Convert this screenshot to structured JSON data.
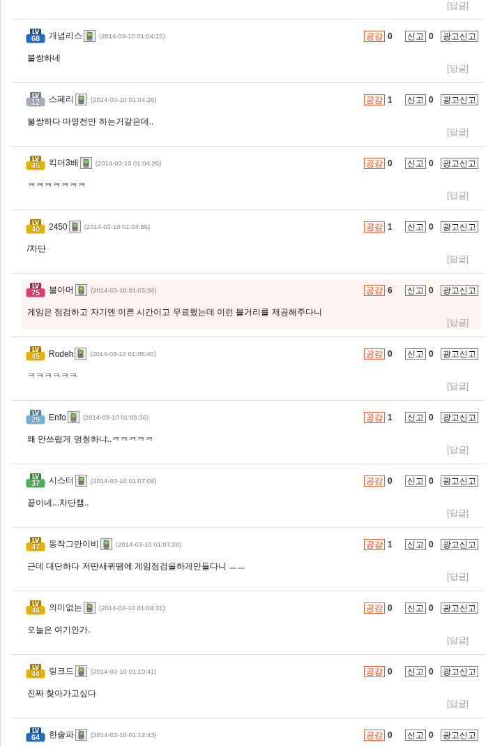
{
  "previous_comment": {
    "reply": "[답글]"
  },
  "comments": [
    {
      "highlighted": false,
      "badge": {
        "label": "LV",
        "number": "68",
        "color": "#1f6cc4"
      },
      "author": "개념리스",
      "time": "(2014-03-10 01:04:15)",
      "like": {
        "label": "공감",
        "count": "0"
      },
      "report": {
        "label": "신고",
        "count": "0"
      },
      "ad_report": {
        "label": "광고신고"
      },
      "text": "불쌍하네",
      "reply": "[답글]"
    },
    {
      "highlighted": false,
      "badge": {
        "label": "LV",
        "number": "12",
        "color": "#a3afbe"
      },
      "author": "스페리",
      "time": "(2014-03-10 01:04:26)",
      "like": {
        "label": "공감",
        "count": "1"
      },
      "report": {
        "label": "신고",
        "count": "0"
      },
      "ad_report": {
        "label": "광고신고"
      },
      "text": "불쌍하다 마영전만 하는거같은데..",
      "reply": "[답글]"
    },
    {
      "highlighted": false,
      "badge": {
        "label": "LV",
        "number": "45",
        "color": "#e8b000"
      },
      "author": "킥더3배",
      "time": "(2014-03-10 01:04:26)",
      "like": {
        "label": "공감",
        "count": "0"
      },
      "report": {
        "label": "신고",
        "count": "0"
      },
      "ad_report": {
        "label": "광고신고"
      },
      "text": "ㅋㅋㅋㅋㅋㅋㅋ",
      "reply": "[답글]"
    },
    {
      "highlighted": false,
      "badge": {
        "label": "LV",
        "number": "40",
        "color": "#e8b000"
      },
      "author": "2450",
      "time": "(2014-03-10 01:04:56)",
      "like": {
        "label": "공감",
        "count": "1"
      },
      "report": {
        "label": "신고",
        "count": "0"
      },
      "ad_report": {
        "label": "광고신고"
      },
      "text": "/차단",
      "reply": "[답글]"
    },
    {
      "highlighted": true,
      "badge": {
        "label": "LV",
        "number": "75",
        "color": "#e23c78"
      },
      "author": "불아머",
      "time": "(2014-03-10 01:05:30)",
      "like": {
        "label": "공감",
        "count": "6"
      },
      "report": {
        "label": "신고",
        "count": "0"
      },
      "ad_report": {
        "label": "광고신고"
      },
      "text": "게임은 점검하고 자기엔 이른 시간이고 무료했는데 이런 볼거리를 제공해주다니",
      "reply": "[답글]"
    },
    {
      "highlighted": false,
      "badge": {
        "label": "LV",
        "number": "45",
        "color": "#e8b000"
      },
      "author": "Rodeh",
      "time": "(2014-03-10 01:05:40)",
      "like": {
        "label": "공감",
        "count": "0"
      },
      "report": {
        "label": "신고",
        "count": "0"
      },
      "ad_report": {
        "label": "광고신고"
      },
      "text": "ㅋㅋㅋㅋㅋㅋ",
      "reply": "[답글]"
    },
    {
      "highlighted": false,
      "badge": {
        "label": "LV",
        "number": "29",
        "color": "#6fb0d6"
      },
      "author": "Enfo",
      "time": "(2014-03-10 01:06:36)",
      "like": {
        "label": "공감",
        "count": "1"
      },
      "report": {
        "label": "신고",
        "count": "0"
      },
      "ad_report": {
        "label": "광고신고"
      },
      "text": "왜 안쓰럽게 멍청하냐..ㅋㅋㅋㅋㅋ",
      "reply": "[답글]"
    },
    {
      "highlighted": false,
      "badge": {
        "label": "LV",
        "number": "37",
        "color": "#4fae5a"
      },
      "author": "시스터",
      "time": "(2014-03-10 01:07:09)",
      "like": {
        "label": "공감",
        "count": "0"
      },
      "report": {
        "label": "신고",
        "count": "0"
      },
      "ad_report": {
        "label": "광고신고"
      },
      "text": "끝이네...차단잼..",
      "reply": "[답글]"
    },
    {
      "highlighted": false,
      "badge": {
        "label": "LV",
        "number": "47",
        "color": "#e8b000"
      },
      "author": "동작그만이비",
      "time": "(2014-03-10 01:07:28)",
      "like": {
        "label": "공감",
        "count": "1"
      },
      "report": {
        "label": "신고",
        "count": "0"
      },
      "ad_report": {
        "label": "광고신고"
      },
      "text": "근데 대단하다 저딴새퀴땜에 게임점검을하게만들다니 ㅡㅡ",
      "reply": "[답글]"
    },
    {
      "highlighted": false,
      "badge": {
        "label": "LV",
        "number": "46",
        "color": "#e8b000"
      },
      "author": "의미없는",
      "time": "(2014-03-10 01:08:31)",
      "like": {
        "label": "공감",
        "count": "0"
      },
      "report": {
        "label": "신고",
        "count": "0"
      },
      "ad_report": {
        "label": "광고신고"
      },
      "text": "오늘은 여기인가.",
      "reply": "[답글]"
    },
    {
      "highlighted": false,
      "badge": {
        "label": "LV",
        "number": "44",
        "color": "#e8b000"
      },
      "author": "링크드",
      "time": "(2014-03-10 01:10:41)",
      "like": {
        "label": "공감",
        "count": "0"
      },
      "report": {
        "label": "신고",
        "count": "0"
      },
      "ad_report": {
        "label": "광고신고"
      },
      "text": "진짜 찾아가고싶다",
      "reply": "[답글]"
    },
    {
      "highlighted": false,
      "badge": {
        "label": "LV",
        "number": "64",
        "color": "#1f6cc4"
      },
      "author": "한솔파",
      "time": "(2014-03-10 01:12:43)",
      "like": {
        "label": "공감",
        "count": "0"
      },
      "report": {
        "label": "신고",
        "count": "0"
      },
      "ad_report": {
        "label": "광고신고"
      }
    }
  ]
}
